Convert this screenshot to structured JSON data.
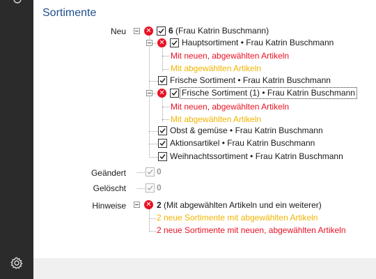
{
  "section_title": "Sortimente",
  "groups": {
    "neu": {
      "label": "Neu",
      "count": "6",
      "summary": " (Frau Katrin Buschmann)",
      "haupt": "Hauptsortiment • Frau Katrin Buschmann",
      "haupt_new": "Mit neuen, abgewählten Artikeln",
      "haupt_deselected": "Mit abgewählten Artikeln",
      "frische": "Frische Sortiment • Frau Katrin Buschmann",
      "frische1": "Frische Sortiment (1) • Frau Katrin Buschmann",
      "frische1_new": "Mit neuen, abgewählten Artikeln",
      "frische1_deselected": "Mit abgewählten Artikeln",
      "obst": "Obst & gemüse • Frau Katrin Buschmann",
      "aktion": "Aktionsartikel • Frau Katrin Buschmann",
      "weihnacht": "Weihnachtssortiment • Frau Katrin Buschmann"
    },
    "geaendert": {
      "label": "Geändert",
      "count": "0"
    },
    "geloescht": {
      "label": "Gelöscht",
      "count": "0"
    },
    "hinweise": {
      "label": "Hinweise",
      "count": "2",
      "summary": " (Mit abgewählten Artikeln und ein weiterer)",
      "item1": "2 neue Sortimente mit abgewählten Artikeln",
      "item2": "2 neue Sortimente mit neuen, abgewählten Artikeln"
    }
  },
  "icons": {
    "top": "sync-icon",
    "settings": "gear-icon",
    "error": "error-icon",
    "checkbox": "checkbox-checked-icon",
    "expander": "collapse-icon"
  },
  "colors": {
    "title": "#1f4e8c",
    "error": "#e81123",
    "warning": "#f0b400",
    "sidebar": "#2b2b2b"
  }
}
